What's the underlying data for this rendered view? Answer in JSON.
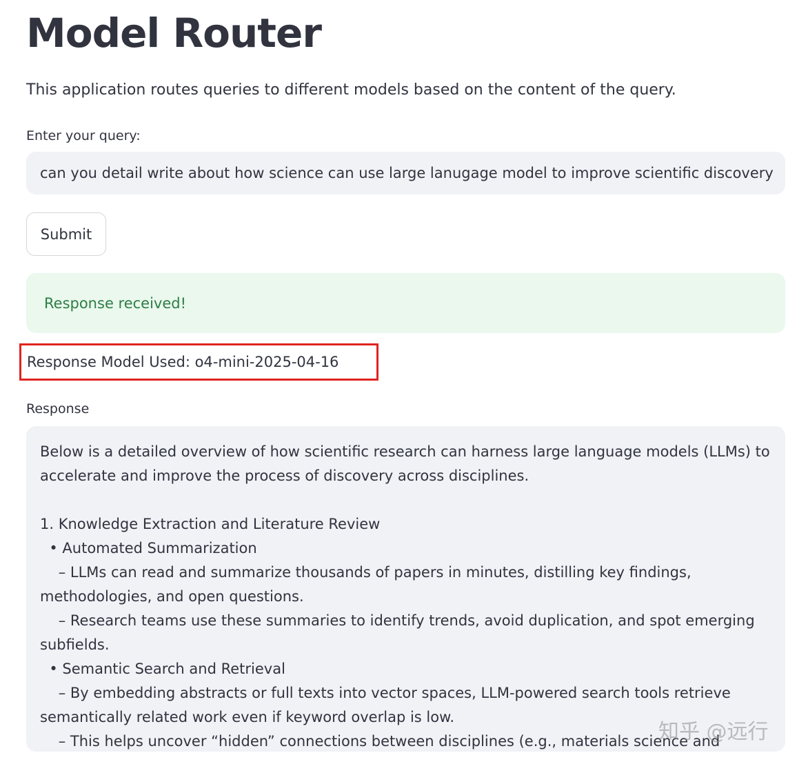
{
  "app": {
    "title": "Model Router",
    "description": "This application routes queries to different models based on the content of the query."
  },
  "query": {
    "label": "Enter your query:",
    "value": "can you detail write about how science can use large lanugage model to improve scientific discovery"
  },
  "submit": {
    "label": "Submit"
  },
  "alert": {
    "message": "Response received!",
    "color": "#2e7d45",
    "background": "#eaf8ed"
  },
  "model_used": {
    "text": "Response Model Used: o4-mini-2025-04-16",
    "highlight_color": "#e0241f"
  },
  "response": {
    "label": "Response",
    "body": "Below is a detailed overview of how scientific research can harness large language models (LLMs) to\naccelerate and improve the process of discovery across disciplines.\n\n1. Knowledge Extraction and Literature Review\n  • Automated Summarization\n    – LLMs can read and summarize thousands of papers in minutes, distilling key findings,\nmethodologies, and open questions.\n    – Research teams use these summaries to identify trends, avoid duplication, and spot emerging\nsubfields.\n  • Semantic Search and Retrieval\n    – By embedding abstracts or full texts into vector spaces, LLM-powered search tools retrieve\nsemantically related work even if keyword overlap is low.\n    – This helps uncover “hidden” connections between disciplines (e.g., materials science and"
  },
  "watermark": {
    "text": "知乎 @远行"
  }
}
